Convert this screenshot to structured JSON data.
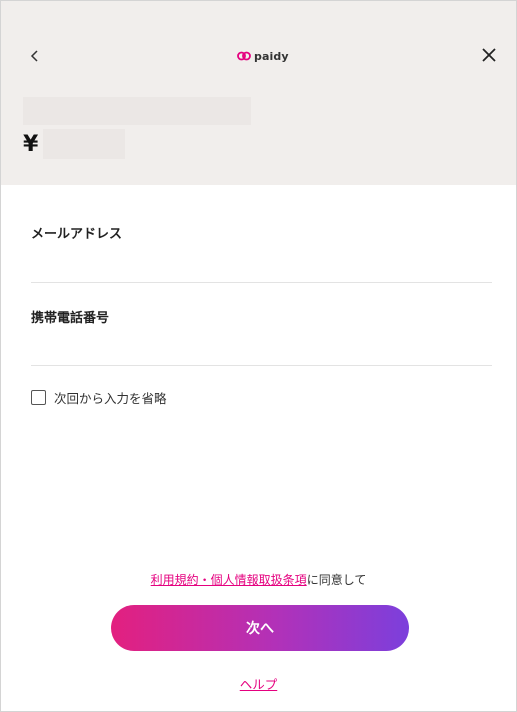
{
  "header": {
    "back_icon": "chevron-left-icon",
    "close_icon": "close-icon",
    "logo_text": "paidy",
    "brand_color": "#e5007f",
    "currency_symbol": "¥"
  },
  "form": {
    "email_label": "メールアドレス",
    "email_value": "",
    "phone_label": "携帯電話番号",
    "phone_value": "",
    "remember_label": "次回から入力を省略",
    "remember_checked": false
  },
  "footer": {
    "terms_link": "利用規約・個人情報取扱条項",
    "terms_suffix": "に同意して",
    "next_label": "次へ",
    "help_label": "ヘルプ",
    "button_gradient": [
      "#e3207f",
      "#b231b8",
      "#7c3fdc"
    ]
  }
}
